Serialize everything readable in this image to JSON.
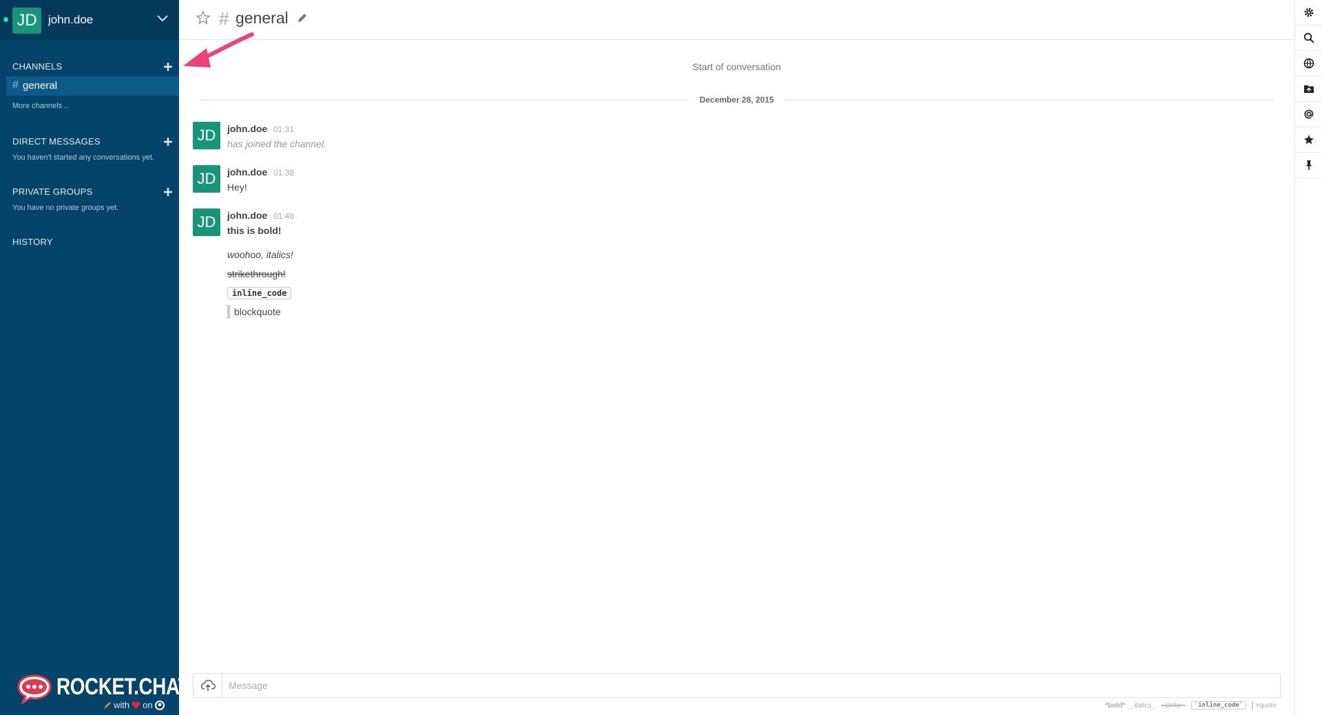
{
  "account": {
    "initials": "JD",
    "username": "john.doe"
  },
  "sidebar": {
    "channels_title": "CHANNELS",
    "active_channel": "general",
    "more_channels": "More channels ..",
    "direct_title": "DIRECT MESSAGES",
    "direct_empty": "You haven't started any conversations yet.",
    "private_title": "PRIVATE GROUPS",
    "private_empty": "You have no private groups yet.",
    "history_title": "HISTORY"
  },
  "brand": {
    "name": "ROCKET.CHAT",
    "with": "with",
    "on": "on"
  },
  "room": {
    "hash": "#",
    "name": "general"
  },
  "conversation": {
    "start": "Start of conversation",
    "date": "December 28, 2015",
    "messages": [
      {
        "initials": "JD",
        "user": "john.doe",
        "time": "01:31",
        "text": "has joined the channel."
      },
      {
        "initials": "JD",
        "user": "john.doe",
        "time": "01:38",
        "text": "Hey!"
      },
      {
        "initials": "JD",
        "user": "john.doe",
        "time": "01:48",
        "text": "this is bold!"
      }
    ],
    "extra_lines": {
      "italic": "woohoo, italics!",
      "strike": "strikethrough!",
      "code": "inline_code",
      "quote": "blockquote"
    }
  },
  "composer": {
    "placeholder": "Message",
    "hints": {
      "bold": "*bold*",
      "italic": "_italics_",
      "strike": "~strike~",
      "code": "`inline_code`",
      "quote": ">quote"
    }
  },
  "colors": {
    "sidebar": "#04436a",
    "avatar": "#17957b",
    "accent_arrow": "#f0407a"
  }
}
